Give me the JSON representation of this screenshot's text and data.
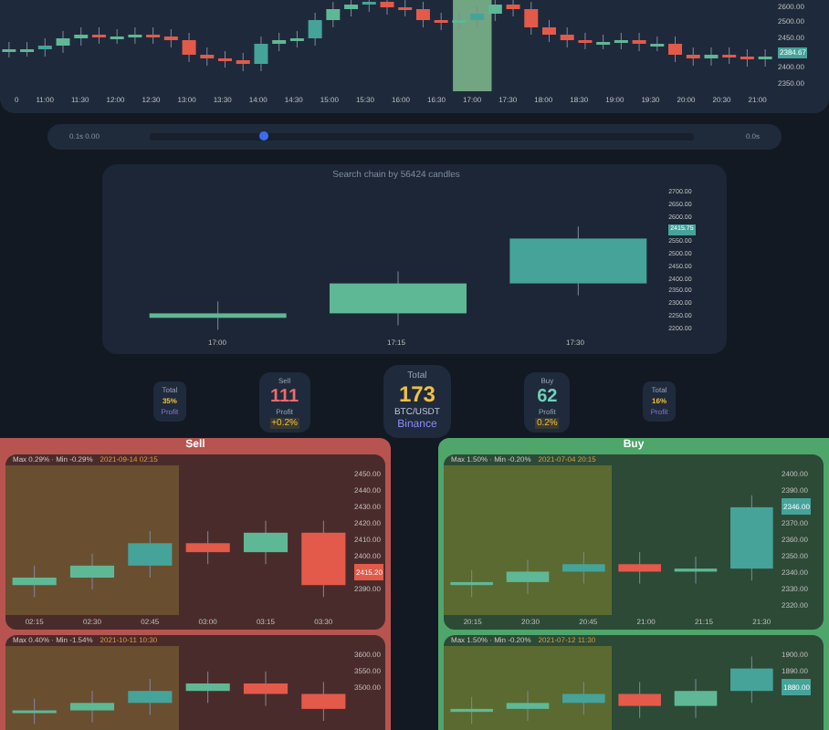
{
  "top_chart": {
    "x_labels": [
      "0",
      "11:00",
      "11:30",
      "12:00",
      "12:30",
      "13:00",
      "13:30",
      "14:00",
      "14:30",
      "15:00",
      "15:30",
      "16:00",
      "16:30",
      "17:00",
      "17:30",
      "18:00",
      "18:30",
      "19:00",
      "19:30",
      "20:00",
      "20:30",
      "21:00"
    ],
    "y_labels": [
      {
        "kind": "tick",
        "text": "2600.00"
      },
      {
        "kind": "tick",
        "text": "2500.00"
      },
      {
        "kind": "tick",
        "text": "2450.00"
      },
      {
        "kind": "price",
        "text": "2384.67"
      },
      {
        "kind": "tick",
        "text": "2400.00"
      },
      {
        "kind": "tick",
        "text": "2350.00"
      }
    ]
  },
  "slider": {
    "left_label": "0.1s 0.00",
    "right_label": "0.0s",
    "level": 0.2
  },
  "search_chart": {
    "title": "Search chain by 56424 candles",
    "y_labels": [
      {
        "kind": "tick",
        "text": "2700.00"
      },
      {
        "kind": "tick",
        "text": "2650.00"
      },
      {
        "kind": "tick",
        "text": "2600.00"
      },
      {
        "kind": "price",
        "text": "2415.75"
      },
      {
        "kind": "tick",
        "text": "2550.00"
      },
      {
        "kind": "tick",
        "text": "2500.00"
      },
      {
        "kind": "tick",
        "text": "2450.00"
      },
      {
        "kind": "tick",
        "text": "2400.00"
      },
      {
        "kind": "tick",
        "text": "2350.00"
      },
      {
        "kind": "tick",
        "text": "2300.00"
      },
      {
        "kind": "tick",
        "text": "2250.00"
      },
      {
        "kind": "tick",
        "text": "2200.00"
      }
    ],
    "x_labels": [
      "17:00",
      "17:15",
      "17:30"
    ]
  },
  "stats": [
    {
      "kind": "small",
      "label": "Total",
      "value": "35%",
      "sub": "Profit"
    },
    {
      "kind": "medium",
      "label": "Sell",
      "value": "111",
      "sub": "Profit",
      "change": "+0.2%",
      "color": "#f06a6a"
    },
    {
      "kind": "large",
      "label": "Total",
      "value": "173",
      "sub": "BTC/USDT",
      "change": "Binance"
    },
    {
      "kind": "medium",
      "label": "Buy",
      "value": "62",
      "sub": "Profit",
      "change": "0.2%",
      "color": "#6fd0b8"
    },
    {
      "kind": "small",
      "label": "Total",
      "value": "16%",
      "sub": "Profit"
    }
  ],
  "panels": [
    {
      "title": "Sell",
      "kind": "sell",
      "charts": [
        {
          "range": "Max 0.29% · Min -0.29%",
          "date": "2021-09-14 02:15",
          "y_labels": [
            {
              "kind": "tick",
              "text": "2450.00"
            },
            {
              "kind": "tick",
              "text": "2440.00"
            },
            {
              "kind": "tick",
              "text": "2430.00"
            },
            {
              "kind": "tick",
              "text": "2420.00"
            },
            {
              "kind": "tick",
              "text": "2410.00"
            },
            {
              "kind": "tick",
              "text": "2400.00"
            },
            {
              "kind": "price",
              "text": "2415.20"
            },
            {
              "kind": "tick",
              "text": "2390.00"
            }
          ],
          "x_labels": [
            "02:15",
            "02:30",
            "02:45",
            "03:00",
            "03:15",
            "03:30"
          ]
        },
        {
          "range": "Max 0.40% · Min -1.54%",
          "date": "2021-10-11 10:30",
          "y_labels": [
            {
              "kind": "tick",
              "text": "3600.00"
            },
            {
              "kind": "tick",
              "text": "3550.00"
            },
            {
              "kind": "tick",
              "text": "3500.00"
            }
          ]
        }
      ]
    },
    {
      "title": "Buy",
      "kind": "buy",
      "charts": [
        {
          "range": "Max 1.50% · Min -0.20%",
          "date": "2021-07-04 20:15",
          "y_labels": [
            {
              "kind": "tick",
              "text": "2400.00"
            },
            {
              "kind": "tick",
              "text": "2390.00"
            },
            {
              "kind": "price",
              "text": "2346.00"
            },
            {
              "kind": "tick",
              "text": "2370.00"
            },
            {
              "kind": "tick",
              "text": "2360.00"
            },
            {
              "kind": "tick",
              "text": "2350.00"
            },
            {
              "kind": "tick",
              "text": "2340.00"
            },
            {
              "kind": "tick",
              "text": "2330.00"
            },
            {
              "kind": "tick",
              "text": "2320.00"
            }
          ],
          "x_labels": [
            "20:15",
            "20:30",
            "20:45",
            "21:00",
            "21:15",
            "21:30"
          ]
        },
        {
          "range": "Max 1.50% · Min -0.20%",
          "date": "2021-07-12 11:30",
          "y_labels": [
            {
              "kind": "tick",
              "text": "1900.00"
            },
            {
              "kind": "tick",
              "text": "1890.00"
            },
            {
              "kind": "price",
              "text": "1880.00"
            }
          ]
        }
      ]
    }
  ]
}
